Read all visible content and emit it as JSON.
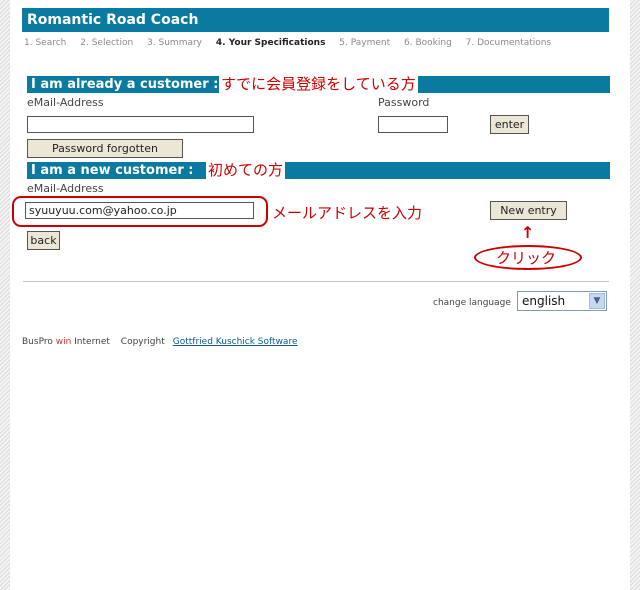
{
  "app": {
    "title": "Romantic Road Coach"
  },
  "steps": [
    "1. Search",
    "2. Selection",
    "3. Summary",
    "4. Your Specifications",
    "5. Payment",
    "6. Booking",
    "7. Documentations"
  ],
  "existing": {
    "heading": "I am already a customer :",
    "annotation": "すでに会員登録をしている方",
    "email_label": "eMail-Address",
    "email_value": "",
    "password_label": "Password",
    "password_value": "",
    "enter_button": "enter",
    "forgot_button": "Password forgotten"
  },
  "newcust": {
    "heading": "I am a new customer :",
    "annotation": "初めての方",
    "email_label": "eMail-Address",
    "email_value": "syuuyuu.com@yahoo.co.jp",
    "email_annotation": "メールアドレスを入力",
    "new_entry_button": "New entry",
    "back_button": "back",
    "click_annotation": "クリック",
    "arrow_glyph": "↑"
  },
  "language": {
    "label": "change language",
    "selected": "english"
  },
  "footer": {
    "brand_a": "BusPro ",
    "brand_b": "win",
    "brand_c": " Internet",
    "copyright": "Copyright",
    "link": "Gottfried Kuschick Software"
  },
  "colors": {
    "header_bg": "#0b7aa0",
    "annotation": "#cc0000",
    "button_bg": "#ece6d6"
  }
}
